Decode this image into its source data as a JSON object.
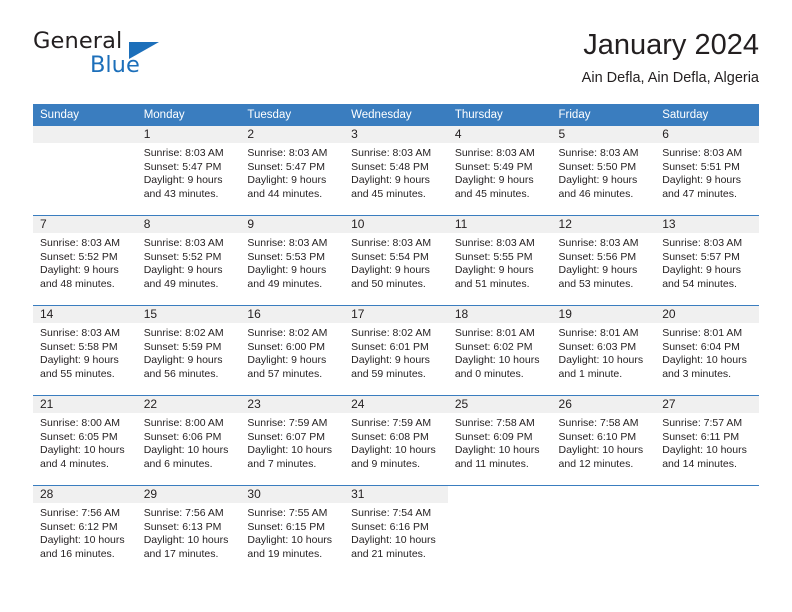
{
  "brand": {
    "name_dark": "General",
    "name_blue": "Blue",
    "accent_color": "#1c6fba"
  },
  "header": {
    "title": "January 2024",
    "subtitle": "Ain Defla, Ain Defla, Algeria",
    "header_bg_color": "#3a7dbf",
    "daynum_bg_color": "#f0f0f0"
  },
  "weekday_headers": [
    "Sunday",
    "Monday",
    "Tuesday",
    "Wednesday",
    "Thursday",
    "Friday",
    "Saturday"
  ],
  "labels": {
    "sunrise_prefix": "Sunrise:",
    "sunset_prefix": "Sunset:",
    "daylight_prefix": "Daylight:"
  },
  "weeks": [
    [
      {
        "day": "",
        "empty": true
      },
      {
        "day": "1",
        "sunrise": "Sunrise: 8:03 AM",
        "sunset": "Sunset: 5:47 PM",
        "daylight1": "Daylight: 9 hours",
        "daylight2": "and 43 minutes."
      },
      {
        "day": "2",
        "sunrise": "Sunrise: 8:03 AM",
        "sunset": "Sunset: 5:47 PM",
        "daylight1": "Daylight: 9 hours",
        "daylight2": "and 44 minutes."
      },
      {
        "day": "3",
        "sunrise": "Sunrise: 8:03 AM",
        "sunset": "Sunset: 5:48 PM",
        "daylight1": "Daylight: 9 hours",
        "daylight2": "and 45 minutes."
      },
      {
        "day": "4",
        "sunrise": "Sunrise: 8:03 AM",
        "sunset": "Sunset: 5:49 PM",
        "daylight1": "Daylight: 9 hours",
        "daylight2": "and 45 minutes."
      },
      {
        "day": "5",
        "sunrise": "Sunrise: 8:03 AM",
        "sunset": "Sunset: 5:50 PM",
        "daylight1": "Daylight: 9 hours",
        "daylight2": "and 46 minutes."
      },
      {
        "day": "6",
        "sunrise": "Sunrise: 8:03 AM",
        "sunset": "Sunset: 5:51 PM",
        "daylight1": "Daylight: 9 hours",
        "daylight2": "and 47 minutes."
      }
    ],
    [
      {
        "day": "7",
        "sunrise": "Sunrise: 8:03 AM",
        "sunset": "Sunset: 5:52 PM",
        "daylight1": "Daylight: 9 hours",
        "daylight2": "and 48 minutes."
      },
      {
        "day": "8",
        "sunrise": "Sunrise: 8:03 AM",
        "sunset": "Sunset: 5:52 PM",
        "daylight1": "Daylight: 9 hours",
        "daylight2": "and 49 minutes."
      },
      {
        "day": "9",
        "sunrise": "Sunrise: 8:03 AM",
        "sunset": "Sunset: 5:53 PM",
        "daylight1": "Daylight: 9 hours",
        "daylight2": "and 49 minutes."
      },
      {
        "day": "10",
        "sunrise": "Sunrise: 8:03 AM",
        "sunset": "Sunset: 5:54 PM",
        "daylight1": "Daylight: 9 hours",
        "daylight2": "and 50 minutes."
      },
      {
        "day": "11",
        "sunrise": "Sunrise: 8:03 AM",
        "sunset": "Sunset: 5:55 PM",
        "daylight1": "Daylight: 9 hours",
        "daylight2": "and 51 minutes."
      },
      {
        "day": "12",
        "sunrise": "Sunrise: 8:03 AM",
        "sunset": "Sunset: 5:56 PM",
        "daylight1": "Daylight: 9 hours",
        "daylight2": "and 53 minutes."
      },
      {
        "day": "13",
        "sunrise": "Sunrise: 8:03 AM",
        "sunset": "Sunset: 5:57 PM",
        "daylight1": "Daylight: 9 hours",
        "daylight2": "and 54 minutes."
      }
    ],
    [
      {
        "day": "14",
        "sunrise": "Sunrise: 8:03 AM",
        "sunset": "Sunset: 5:58 PM",
        "daylight1": "Daylight: 9 hours",
        "daylight2": "and 55 minutes."
      },
      {
        "day": "15",
        "sunrise": "Sunrise: 8:02 AM",
        "sunset": "Sunset: 5:59 PM",
        "daylight1": "Daylight: 9 hours",
        "daylight2": "and 56 minutes."
      },
      {
        "day": "16",
        "sunrise": "Sunrise: 8:02 AM",
        "sunset": "Sunset: 6:00 PM",
        "daylight1": "Daylight: 9 hours",
        "daylight2": "and 57 minutes."
      },
      {
        "day": "17",
        "sunrise": "Sunrise: 8:02 AM",
        "sunset": "Sunset: 6:01 PM",
        "daylight1": "Daylight: 9 hours",
        "daylight2": "and 59 minutes."
      },
      {
        "day": "18",
        "sunrise": "Sunrise: 8:01 AM",
        "sunset": "Sunset: 6:02 PM",
        "daylight1": "Daylight: 10 hours",
        "daylight2": "and 0 minutes."
      },
      {
        "day": "19",
        "sunrise": "Sunrise: 8:01 AM",
        "sunset": "Sunset: 6:03 PM",
        "daylight1": "Daylight: 10 hours",
        "daylight2": "and 1 minute."
      },
      {
        "day": "20",
        "sunrise": "Sunrise: 8:01 AM",
        "sunset": "Sunset: 6:04 PM",
        "daylight1": "Daylight: 10 hours",
        "daylight2": "and 3 minutes."
      }
    ],
    [
      {
        "day": "21",
        "sunrise": "Sunrise: 8:00 AM",
        "sunset": "Sunset: 6:05 PM",
        "daylight1": "Daylight: 10 hours",
        "daylight2": "and 4 minutes."
      },
      {
        "day": "22",
        "sunrise": "Sunrise: 8:00 AM",
        "sunset": "Sunset: 6:06 PM",
        "daylight1": "Daylight: 10 hours",
        "daylight2": "and 6 minutes."
      },
      {
        "day": "23",
        "sunrise": "Sunrise: 7:59 AM",
        "sunset": "Sunset: 6:07 PM",
        "daylight1": "Daylight: 10 hours",
        "daylight2": "and 7 minutes."
      },
      {
        "day": "24",
        "sunrise": "Sunrise: 7:59 AM",
        "sunset": "Sunset: 6:08 PM",
        "daylight1": "Daylight: 10 hours",
        "daylight2": "and 9 minutes."
      },
      {
        "day": "25",
        "sunrise": "Sunrise: 7:58 AM",
        "sunset": "Sunset: 6:09 PM",
        "daylight1": "Daylight: 10 hours",
        "daylight2": "and 11 minutes."
      },
      {
        "day": "26",
        "sunrise": "Sunrise: 7:58 AM",
        "sunset": "Sunset: 6:10 PM",
        "daylight1": "Daylight: 10 hours",
        "daylight2": "and 12 minutes."
      },
      {
        "day": "27",
        "sunrise": "Sunrise: 7:57 AM",
        "sunset": "Sunset: 6:11 PM",
        "daylight1": "Daylight: 10 hours",
        "daylight2": "and 14 minutes."
      }
    ],
    [
      {
        "day": "28",
        "sunrise": "Sunrise: 7:56 AM",
        "sunset": "Sunset: 6:12 PM",
        "daylight1": "Daylight: 10 hours",
        "daylight2": "and 16 minutes."
      },
      {
        "day": "29",
        "sunrise": "Sunrise: 7:56 AM",
        "sunset": "Sunset: 6:13 PM",
        "daylight1": "Daylight: 10 hours",
        "daylight2": "and 17 minutes."
      },
      {
        "day": "30",
        "sunrise": "Sunrise: 7:55 AM",
        "sunset": "Sunset: 6:15 PM",
        "daylight1": "Daylight: 10 hours",
        "daylight2": "and 19 minutes."
      },
      {
        "day": "31",
        "sunrise": "Sunrise: 7:54 AM",
        "sunset": "Sunset: 6:16 PM",
        "daylight1": "Daylight: 10 hours",
        "daylight2": "and 21 minutes."
      },
      {
        "day": "",
        "empty": true,
        "blank": true
      },
      {
        "day": "",
        "empty": true,
        "blank": true
      },
      {
        "day": "",
        "empty": true,
        "blank": true
      }
    ]
  ]
}
